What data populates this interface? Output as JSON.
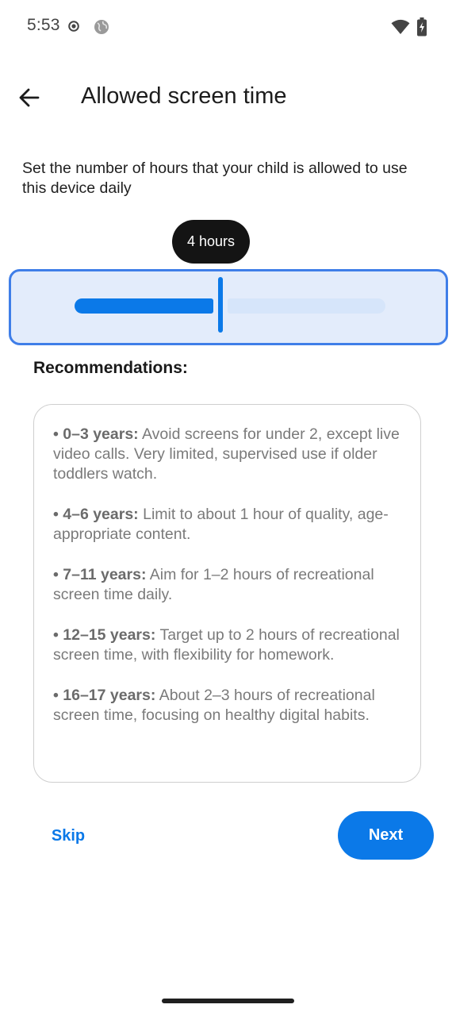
{
  "status_bar": {
    "time": "5:53",
    "icons": [
      "record-icon",
      "globe-icon",
      "wifi-icon",
      "battery-charging-icon"
    ]
  },
  "app_bar": {
    "back_icon": "arrow-back-icon",
    "title": "Allowed screen time"
  },
  "description": "Set the number of hours that your child is allowed to use this device daily",
  "slider": {
    "tooltip_label": "4 hours",
    "value_fraction": 0.47
  },
  "recommendations": {
    "heading": "Recommendations:",
    "items": [
      {
        "bullet": "•",
        "age": "0–3 years:",
        "text": "Avoid screens for under 2, except live video calls. Very limited, supervised use if older toddlers watch."
      },
      {
        "bullet": "•",
        "age": "4–6 years:",
        "text": "Limit to about 1 hour of quality, age-appropriate content."
      },
      {
        "bullet": "•",
        "age": "7–11 years:",
        "text": "Aim for 1–2 hours of recreational screen time daily."
      },
      {
        "bullet": "•",
        "age": "12–15 years:",
        "text": "Target up to 2 hours of recreational screen time, with flexibility for homework."
      },
      {
        "bullet": "•",
        "age": "16–17 years:",
        "text": "About 2–3 hours of recreational screen time, focusing on healthy digital habits."
      }
    ]
  },
  "actions": {
    "skip_label": "Skip",
    "next_label": "Next"
  },
  "colors": {
    "accent": "#0b79e8",
    "slider_background": "#e3ecfb",
    "slider_border": "#3f7ee8",
    "tooltip_background": "#141414"
  }
}
